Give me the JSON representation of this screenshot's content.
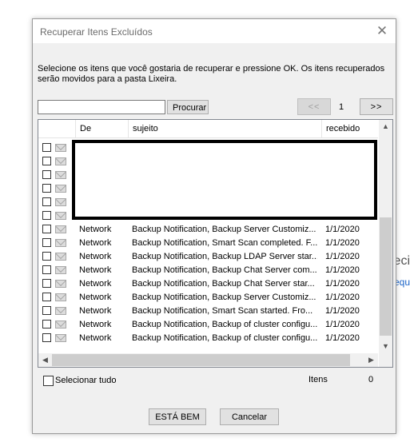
{
  "background": {
    "fragment_text": "eci",
    "fragment_link": "equ"
  },
  "dialog": {
    "title": "Recuperar Itens Excluídos",
    "close_glyph": "✕",
    "instructions": "Selecione os itens que você gostaria de recuperar e pressione OK. Os itens recuperados serão movidos para a pasta Lixeira.",
    "search": {
      "value": "",
      "placeholder": "",
      "button_label": "Procurar"
    },
    "pager": {
      "prev_label": "<<",
      "page": "1",
      "next_label": ">>"
    },
    "columns": {
      "from": "De",
      "subject": "sujeito",
      "received": "recebido"
    },
    "redacted_rows": 6,
    "rows": [
      {
        "from": "Network",
        "subject": "Backup Notification, Backup Server Customiz...",
        "received": "1/1/2020"
      },
      {
        "from": "Network",
        "subject": "Backup Notification, Smart Scan completed. F...",
        "received": "1/1/2020"
      },
      {
        "from": "Network",
        "subject": "Backup Notification, Backup LDAP Server star...",
        "received": "1/1/2020"
      },
      {
        "from": "Network",
        "subject": "Backup Notification, Backup Chat Server com...",
        "received": "1/1/2020"
      },
      {
        "from": "Network",
        "subject": "Backup Notification, Backup Chat Server star...",
        "received": "1/1/2020"
      },
      {
        "from": "Network",
        "subject": "Backup Notification, Backup Server Customiz...",
        "received": "1/1/2020"
      },
      {
        "from": "Network",
        "subject": "Backup Notification, Smart Scan started. Fro...",
        "received": "1/1/2020"
      },
      {
        "from": "Network",
        "subject": "Backup Notification, Backup of cluster configu...",
        "received": "1/1/2020"
      },
      {
        "from": "Network",
        "subject": "Backup Notification, Backup of cluster configu...",
        "received": "1/1/2020"
      }
    ],
    "select_all_label": "Selecionar tudo",
    "items_label": "Itens",
    "items_count": "0",
    "ok_label": "ESTÁ BEM",
    "cancel_label": "Cancelar",
    "icons": {
      "mail": "envelope-icon",
      "close": "close-icon"
    }
  }
}
